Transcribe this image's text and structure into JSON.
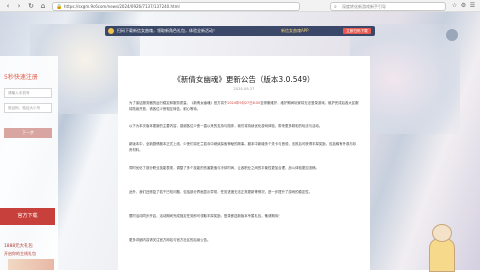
{
  "browser": {
    "back_icon": "‹",
    "forward_icon": "›",
    "reload_icon": "↻",
    "home_icon": "⌂",
    "lock_icon": "🔒",
    "url": "https://sxgm.9c6com/news/2024/0926/7137/137240.html",
    "search_icon": "⌕",
    "search_placeholder": "深度转化新游戏新手引导",
    "toolbar_icons": [
      "☆",
      "⚙",
      "☰"
    ]
  },
  "promo": {
    "text": "扫码下载新信女曲魂，领取新角色礼包，体验全新活动！",
    "tag": "新信女曲魂APP",
    "button": "立即扫码下载"
  },
  "sidebar": {
    "register_title": "5秒快速注册",
    "phone_placeholder": "请输入手机号",
    "code_placeholder": "验证码，验证大小写",
    "next_label": "下一步",
    "download_label": "官方下载",
    "gift_text": "1888元大礼包",
    "gift_sub": "开启你的主线礼包"
  },
  "article": {
    "title": "《新倩女幽魂》更新公告（版本3.0.549）",
    "date": "2024-09-27",
    "paragraphs": [
      {
        "before": "为了保证服务器的运行稳定和服务质量，《新倩女幽魂》官方将于",
        "highlight": "2024年9月27日8:00",
        "after": "至停服维护，维护期间玩家将无法登录游戏。维护完成后各大区服将陆续开放，请各位少侠相互转告，耐心等待。"
      },
      {
        "before": "以下为本次版本更新的主要内容，感谢各位少侠一直以来的支持与陪伴，我们将持续优化游戏体验，带来更多精彩的玩法与活动。",
        "highlight": "",
        "after": ""
      },
      {
        "before": "新版本中，全新剧情副本正式上线，少侠们将在兰若寺中继续探索神秘的故事。副本中新增多个关卡与首领，击败后可获得丰厚奖励，包括稀有外观与珍贵材料。",
        "highlight": "",
        "after": ""
      },
      {
        "before": "同时优化了部分职业技能表现，调整了多个技能的伤害数值与冷却时间，让各职业之间的平衡性更加合理，战斗体验更加流畅。",
        "highlight": "",
        "after": ""
      },
      {
        "before": "此外，我们还修复了若干已知问题，包括部分界面显示异常、任务进度无法正常更新等情况，进一步提升了游戏的稳定性。",
        "highlight": "",
        "after": ""
      },
      {
        "before": "限时活动同步开启，活动期间完成指定任务即可领取丰厚奖励，登录即送新版本专属礼包，敬请期待！",
        "highlight": "",
        "after": ""
      },
      {
        "before": "更多详细内容请关注官方网站与官方社区的后续公告。",
        "highlight": "",
        "after": ""
      }
    ]
  }
}
